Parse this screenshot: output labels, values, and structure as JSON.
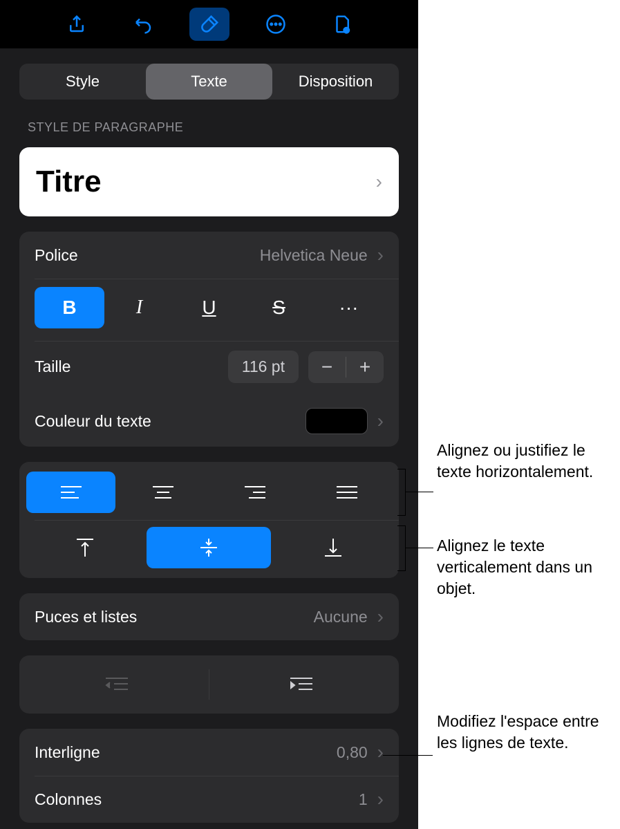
{
  "segmented": {
    "style": "Style",
    "text": "Texte",
    "layout": "Disposition"
  },
  "paragraph": {
    "section_label": "STYLE DE PARAGRAPHE",
    "style_name": "Titre"
  },
  "font": {
    "label": "Police",
    "value": "Helvetica Neue",
    "bold": "B",
    "italic": "I",
    "underline": "U",
    "strike": "S",
    "more": "···"
  },
  "size": {
    "label": "Taille",
    "value": "116 pt",
    "minus": "−",
    "plus": "+"
  },
  "color": {
    "label": "Couleur du texte"
  },
  "bullets": {
    "label": "Puces et listes",
    "value": "Aucune"
  },
  "lineheight": {
    "label": "Interligne",
    "value": "0,80"
  },
  "columns": {
    "label": "Colonnes",
    "value": "1"
  },
  "callouts": {
    "horiz": "Alignez ou justifiez le texte horizontalement.",
    "vert": "Alignez le texte verticalement dans un objet.",
    "spacing": "Modifiez l'espace entre les lignes de texte."
  }
}
